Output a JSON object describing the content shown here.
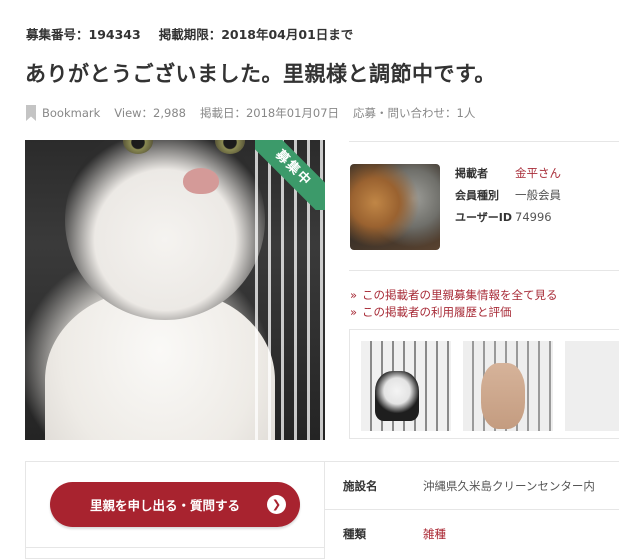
{
  "meta": {
    "recruit_no": "募集番号：194343",
    "deadline": "掲載期限：2018年04月01日まで"
  },
  "title": "ありがとうございました。里親様と調節中です。",
  "stats": {
    "bookmark": "Bookmark",
    "views": "View：2,988",
    "posted": "掲載日：2018年01月07日",
    "inquiries": "応募・問い合わせ：1人"
  },
  "photo": {
    "ribbon": "募集中"
  },
  "poster": {
    "rows": [
      {
        "label": "掲載者",
        "value": "金平さん"
      },
      {
        "label": "会員種別",
        "value": "一般会員"
      },
      {
        "label": "ユーザーID",
        "value": "74996"
      }
    ]
  },
  "links": [
    {
      "chevron": "»",
      "label": "この掲載者の里親募集情報を全て見る"
    },
    {
      "chevron": "»",
      "label": "この掲載者の利用履歴と評価"
    }
  ],
  "apply_button": {
    "label": "里親を申し出る・質問する",
    "arrow": "❯"
  },
  "details": [
    {
      "label": "施設名",
      "value": "沖縄県久米島クリーンセンター内"
    },
    {
      "label": "種類",
      "value": "雑種"
    }
  ],
  "colors": {
    "accent": "#a8232f",
    "ribbon": "#3c9a6a",
    "border": "#e6e6e6"
  }
}
